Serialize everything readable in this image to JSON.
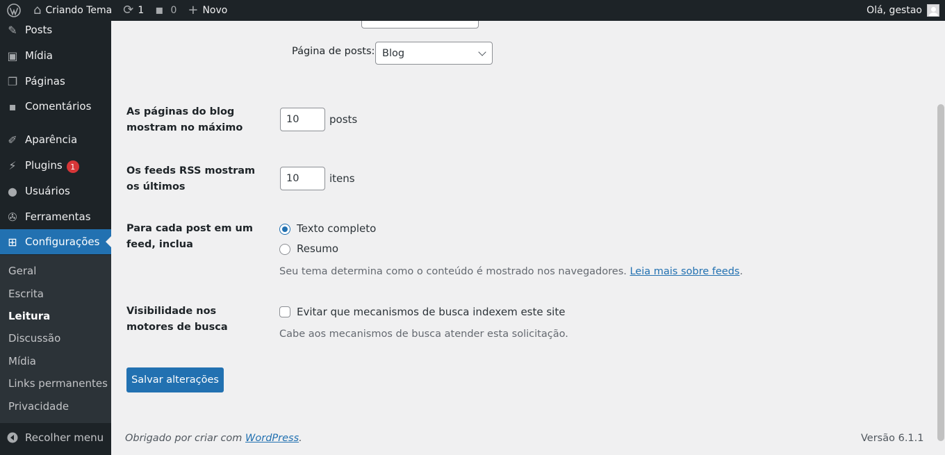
{
  "adminbar": {
    "site_name": "Criando Tema",
    "updates_count": "1",
    "comments_count": "0",
    "new_label": "Novo",
    "greeting": "Olá, gestao"
  },
  "sidebar": {
    "items": [
      {
        "label": "Posts",
        "icon": "pin-icon"
      },
      {
        "label": "Mídia",
        "icon": "media-icon"
      },
      {
        "label": "Páginas",
        "icon": "pages-icon"
      },
      {
        "label": "Comentários",
        "icon": "comment-icon"
      },
      {
        "label": "Aparência",
        "icon": "brush-icon"
      },
      {
        "label": "Plugins",
        "icon": "plugin-icon",
        "badge": "1"
      },
      {
        "label": "Usuários",
        "icon": "user-icon"
      },
      {
        "label": "Ferramentas",
        "icon": "wrench-icon"
      },
      {
        "label": "Configurações",
        "icon": "settings-icon"
      }
    ],
    "submenu": [
      "Geral",
      "Escrita",
      "Leitura",
      "Discussão",
      "Mídia",
      "Links permanentes",
      "Privacidade"
    ],
    "collapse_label": "Recolher menu"
  },
  "form": {
    "posts_page_label": "Página de posts:",
    "posts_page_value": "Blog",
    "blog_pages_label": "As páginas do blog mostram no máximo",
    "blog_pages_value": "10",
    "blog_pages_unit": "posts",
    "rss_label": "Os feeds RSS mostram os últimos",
    "rss_value": "10",
    "rss_unit": "itens",
    "feed_label": "Para cada post em um feed, inclua",
    "feed_full": "Texto completo",
    "feed_summary": "Resumo",
    "feed_desc": "Seu tema determina como o conteúdo é mostrado nos navegadores.",
    "feed_link": "Leia mais sobre feeds",
    "visibility_label": "Visibilidade nos motores de busca",
    "visibility_checkbox": "Evitar que mecanismos de busca indexem este site",
    "visibility_desc": "Cabe aos mecanismos de busca atender esta solicitação.",
    "save_label": "Salvar alterações"
  },
  "footer": {
    "thanks": "Obrigado por criar com",
    "wp_link": "WordPress",
    "version": "Versão 6.1.1"
  }
}
